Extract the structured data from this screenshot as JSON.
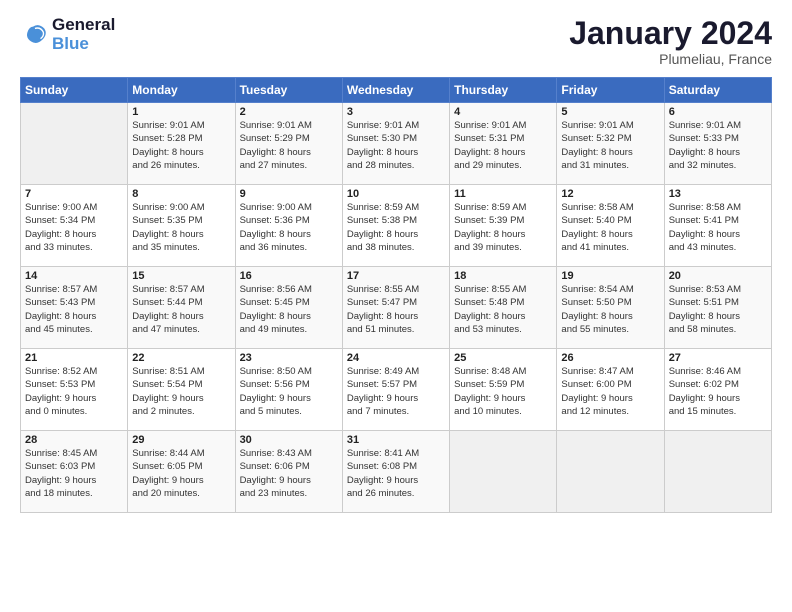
{
  "logo": {
    "line1": "General",
    "line2": "Blue"
  },
  "title": "January 2024",
  "location": "Plumeliau, France",
  "weekdays": [
    "Sunday",
    "Monday",
    "Tuesday",
    "Wednesday",
    "Thursday",
    "Friday",
    "Saturday"
  ],
  "weeks": [
    [
      {
        "day": "",
        "info": ""
      },
      {
        "day": "1",
        "info": "Sunrise: 9:01 AM\nSunset: 5:28 PM\nDaylight: 8 hours\nand 26 minutes."
      },
      {
        "day": "2",
        "info": "Sunrise: 9:01 AM\nSunset: 5:29 PM\nDaylight: 8 hours\nand 27 minutes."
      },
      {
        "day": "3",
        "info": "Sunrise: 9:01 AM\nSunset: 5:30 PM\nDaylight: 8 hours\nand 28 minutes."
      },
      {
        "day": "4",
        "info": "Sunrise: 9:01 AM\nSunset: 5:31 PM\nDaylight: 8 hours\nand 29 minutes."
      },
      {
        "day": "5",
        "info": "Sunrise: 9:01 AM\nSunset: 5:32 PM\nDaylight: 8 hours\nand 31 minutes."
      },
      {
        "day": "6",
        "info": "Sunrise: 9:01 AM\nSunset: 5:33 PM\nDaylight: 8 hours\nand 32 minutes."
      }
    ],
    [
      {
        "day": "7",
        "info": "Sunrise: 9:00 AM\nSunset: 5:34 PM\nDaylight: 8 hours\nand 33 minutes."
      },
      {
        "day": "8",
        "info": "Sunrise: 9:00 AM\nSunset: 5:35 PM\nDaylight: 8 hours\nand 35 minutes."
      },
      {
        "day": "9",
        "info": "Sunrise: 9:00 AM\nSunset: 5:36 PM\nDaylight: 8 hours\nand 36 minutes."
      },
      {
        "day": "10",
        "info": "Sunrise: 8:59 AM\nSunset: 5:38 PM\nDaylight: 8 hours\nand 38 minutes."
      },
      {
        "day": "11",
        "info": "Sunrise: 8:59 AM\nSunset: 5:39 PM\nDaylight: 8 hours\nand 39 minutes."
      },
      {
        "day": "12",
        "info": "Sunrise: 8:58 AM\nSunset: 5:40 PM\nDaylight: 8 hours\nand 41 minutes."
      },
      {
        "day": "13",
        "info": "Sunrise: 8:58 AM\nSunset: 5:41 PM\nDaylight: 8 hours\nand 43 minutes."
      }
    ],
    [
      {
        "day": "14",
        "info": "Sunrise: 8:57 AM\nSunset: 5:43 PM\nDaylight: 8 hours\nand 45 minutes."
      },
      {
        "day": "15",
        "info": "Sunrise: 8:57 AM\nSunset: 5:44 PM\nDaylight: 8 hours\nand 47 minutes."
      },
      {
        "day": "16",
        "info": "Sunrise: 8:56 AM\nSunset: 5:45 PM\nDaylight: 8 hours\nand 49 minutes."
      },
      {
        "day": "17",
        "info": "Sunrise: 8:55 AM\nSunset: 5:47 PM\nDaylight: 8 hours\nand 51 minutes."
      },
      {
        "day": "18",
        "info": "Sunrise: 8:55 AM\nSunset: 5:48 PM\nDaylight: 8 hours\nand 53 minutes."
      },
      {
        "day": "19",
        "info": "Sunrise: 8:54 AM\nSunset: 5:50 PM\nDaylight: 8 hours\nand 55 minutes."
      },
      {
        "day": "20",
        "info": "Sunrise: 8:53 AM\nSunset: 5:51 PM\nDaylight: 8 hours\nand 58 minutes."
      }
    ],
    [
      {
        "day": "21",
        "info": "Sunrise: 8:52 AM\nSunset: 5:53 PM\nDaylight: 9 hours\nand 0 minutes."
      },
      {
        "day": "22",
        "info": "Sunrise: 8:51 AM\nSunset: 5:54 PM\nDaylight: 9 hours\nand 2 minutes."
      },
      {
        "day": "23",
        "info": "Sunrise: 8:50 AM\nSunset: 5:56 PM\nDaylight: 9 hours\nand 5 minutes."
      },
      {
        "day": "24",
        "info": "Sunrise: 8:49 AM\nSunset: 5:57 PM\nDaylight: 9 hours\nand 7 minutes."
      },
      {
        "day": "25",
        "info": "Sunrise: 8:48 AM\nSunset: 5:59 PM\nDaylight: 9 hours\nand 10 minutes."
      },
      {
        "day": "26",
        "info": "Sunrise: 8:47 AM\nSunset: 6:00 PM\nDaylight: 9 hours\nand 12 minutes."
      },
      {
        "day": "27",
        "info": "Sunrise: 8:46 AM\nSunset: 6:02 PM\nDaylight: 9 hours\nand 15 minutes."
      }
    ],
    [
      {
        "day": "28",
        "info": "Sunrise: 8:45 AM\nSunset: 6:03 PM\nDaylight: 9 hours\nand 18 minutes."
      },
      {
        "day": "29",
        "info": "Sunrise: 8:44 AM\nSunset: 6:05 PM\nDaylight: 9 hours\nand 20 minutes."
      },
      {
        "day": "30",
        "info": "Sunrise: 8:43 AM\nSunset: 6:06 PM\nDaylight: 9 hours\nand 23 minutes."
      },
      {
        "day": "31",
        "info": "Sunrise: 8:41 AM\nSunset: 6:08 PM\nDaylight: 9 hours\nand 26 minutes."
      },
      {
        "day": "",
        "info": ""
      },
      {
        "day": "",
        "info": ""
      },
      {
        "day": "",
        "info": ""
      }
    ]
  ]
}
